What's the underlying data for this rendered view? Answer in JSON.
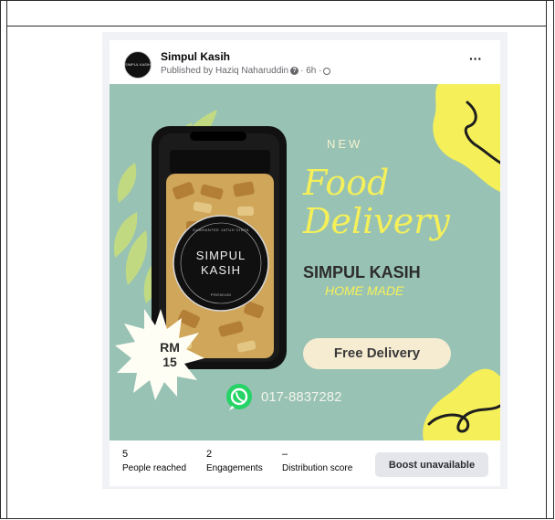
{
  "post": {
    "page_name": "Simpul Kasih",
    "published_by": "Published by Haziq Naharuddin",
    "time": "· 6h ·",
    "avatar_text": "SIMPUL KASIH",
    "more_label": "···"
  },
  "ad": {
    "new_label": "NEW",
    "food_label": "Food",
    "delivery_label": "Delivery",
    "brand": "SIMPUL KASIH",
    "home_made": "HOME MADE",
    "free_delivery": "Free Delivery",
    "phone": "017-8837282",
    "price_currency": "RM",
    "price_value": "15",
    "jar_label_line1": "SIMPUL",
    "jar_label_line2": "KASIH",
    "jar_label_top": "GUARANTEE JATUH CINTA",
    "jar_label_bottom": "PREMIUM"
  },
  "stats": {
    "people_reached_value": "5",
    "people_reached_label": "People reached",
    "engagements_value": "2",
    "engagements_label": "Engagements",
    "distribution_value": "–",
    "distribution_label": "Distribution score",
    "boost_label": "Boost unavailable"
  },
  "colors": {
    "background": "#98c2b4",
    "accent_yellow": "#f5f05a",
    "pill": "#f6ecd2",
    "whatsapp": "#25d366"
  }
}
